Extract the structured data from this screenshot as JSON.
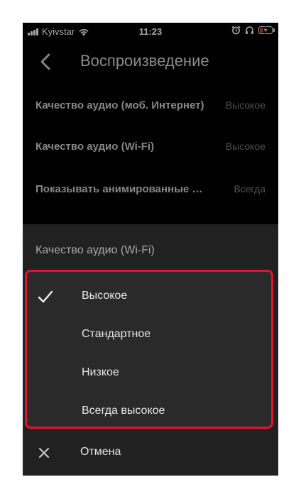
{
  "status_bar": {
    "carrier": "Kyivstar",
    "time": "11:23"
  },
  "header": {
    "title": "Воспроизведение"
  },
  "settings": [
    {
      "label": "Качество аудио (моб. Интернет)",
      "value": "Высокое"
    },
    {
      "label": "Качество аудио (Wi-Fi)",
      "value": "Высокое"
    },
    {
      "label": "Показывать анимированные заставки",
      "value": "Всегда"
    }
  ],
  "sheet": {
    "title": "Качество аудио (Wi-Fi)",
    "options": [
      {
        "label": "Высокое",
        "selected": true
      },
      {
        "label": "Стандартное",
        "selected": false
      },
      {
        "label": "Низкое",
        "selected": false
      },
      {
        "label": "Всегда высокое",
        "selected": false
      }
    ],
    "cancel_label": "Отмена"
  },
  "colors": {
    "background": "#000000",
    "sheet": "#212121",
    "highlight_border": "#e8112d",
    "battery_low": "#e53935"
  }
}
